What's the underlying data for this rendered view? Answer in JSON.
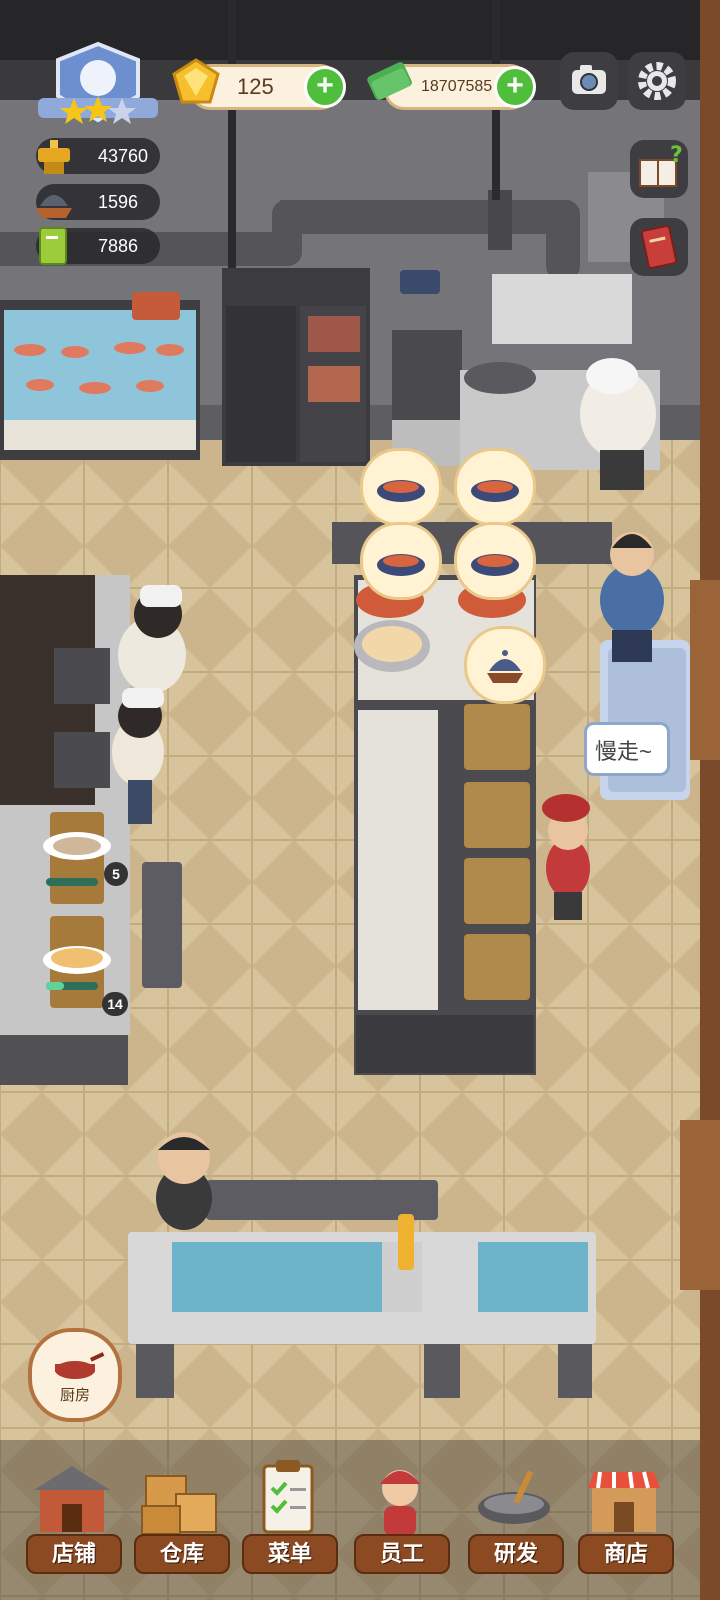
{
  "currency": {
    "gems": "125",
    "cash": "18707585"
  },
  "stats": [
    {
      "icon": "gold-pot-icon",
      "value": "43760"
    },
    {
      "icon": "serving-dish-icon",
      "value": "1596"
    },
    {
      "icon": "green-book-icon",
      "value": "7886"
    }
  ],
  "queue_counts": {
    "first": "5",
    "second": "14"
  },
  "customer_speech": "慢走~",
  "kitchen_button": "厨房",
  "nav": [
    {
      "id": "store",
      "label": "店铺"
    },
    {
      "id": "warehouse",
      "label": "仓库"
    },
    {
      "id": "menu",
      "label": "菜单"
    },
    {
      "id": "staff",
      "label": "员工"
    },
    {
      "id": "research",
      "label": "研发"
    },
    {
      "id": "shop",
      "label": "商店"
    }
  ],
  "restaurant_level_stars": 2,
  "colors": {
    "floor": "#d9c6a1",
    "wall": "#6b6b70",
    "plus_green": "#4fbe3b",
    "nav_brown": "#8c4a22"
  }
}
